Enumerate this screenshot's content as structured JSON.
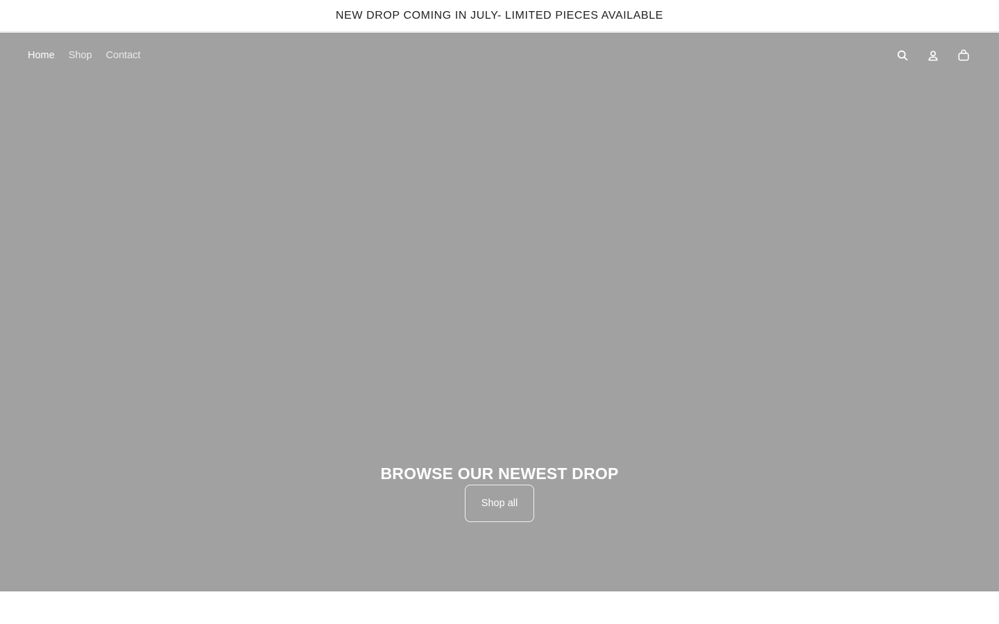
{
  "announcement": {
    "text": "NEW DROP COMING IN JULY- LIMITED PIECES AVAILABLE"
  },
  "header": {
    "nav": [
      {
        "label": "Home",
        "active": true
      },
      {
        "label": "Shop",
        "active": false
      },
      {
        "label": "Contact",
        "active": false
      }
    ],
    "icons": [
      "search-icon",
      "account-icon",
      "cart-icon"
    ]
  },
  "hero": {
    "title": "BROWSE OUR NEWEST DROP",
    "button_label": "Shop all",
    "background_color": "#a1a1a1"
  }
}
